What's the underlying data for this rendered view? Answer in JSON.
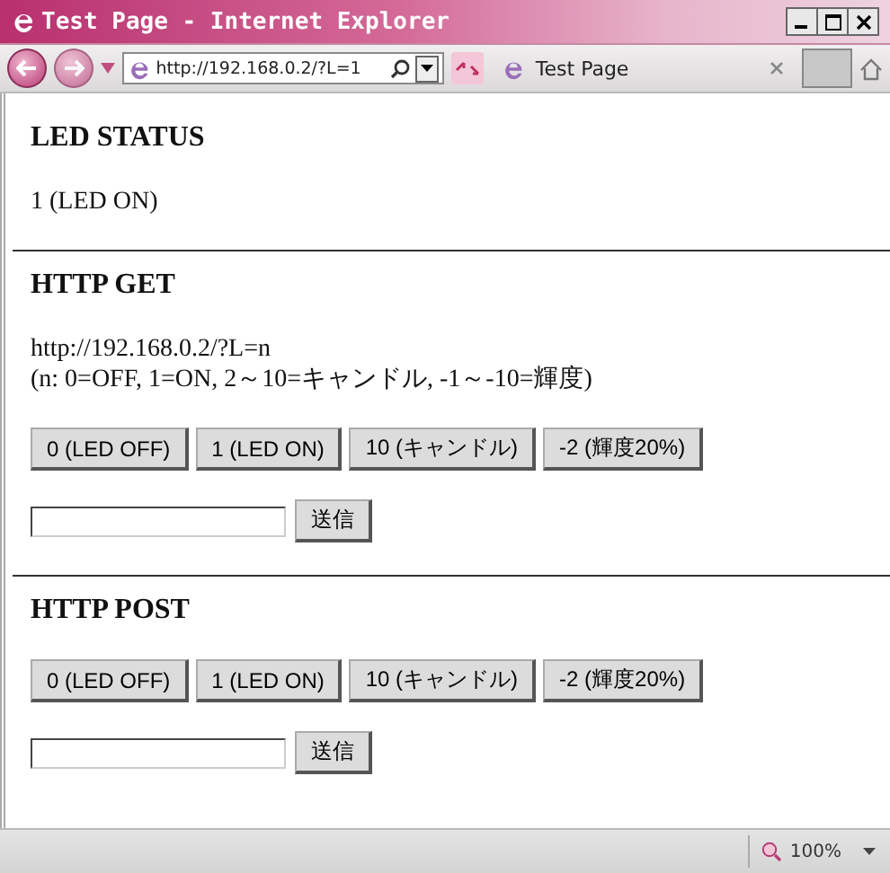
{
  "window": {
    "title": "Test Page - Internet Explorer"
  },
  "toolbar": {
    "address": "http://192.168.0.2/?L=1",
    "tab": "Test Page"
  },
  "sections": [
    {
      "kind": "status",
      "heading": "LED STATUS",
      "value": "1 (LED ON)"
    },
    {
      "kind": "form",
      "heading": "HTTP GET",
      "lines": [
        "http://192.168.0.2/?L=n",
        "(n: 0=OFF, 1=ON, 2～10=キャンドル, -1～-10=輝度)"
      ],
      "buttons": [
        "0 (LED OFF)",
        "1 (LED ON)",
        "10 (キャンドル)",
        "-2 (輝度20%)"
      ],
      "submit": "送信"
    },
    {
      "kind": "form",
      "heading": "HTTP POST",
      "buttons": [
        "0 (LED OFF)",
        "1 (LED ON)",
        "10 (キャンドル)",
        "-2 (輝度20%)"
      ],
      "submit": "送信"
    }
  ],
  "status_bar": {
    "zoom": "100%"
  }
}
